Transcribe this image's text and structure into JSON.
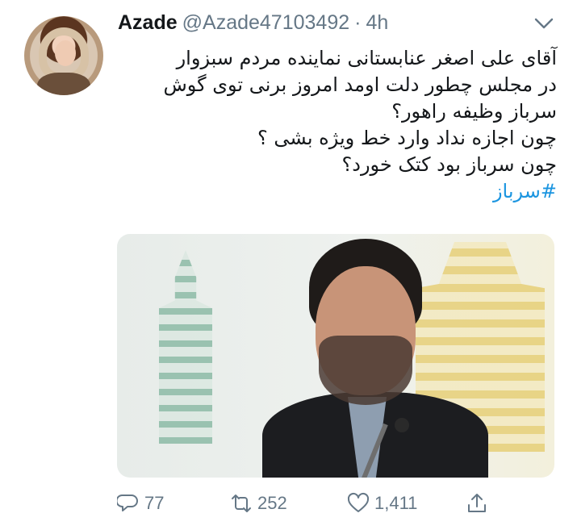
{
  "tweet": {
    "author_name": "Azade",
    "author_handle": "@Azade47103492",
    "separator": "·",
    "time": "4h",
    "lines": [
      "آقای علی اصغر عنابستانی نماینده مردم سبزوار",
      "در مجلس چطور دلت اومد امروز برنی توی گوش",
      "سرباز وظیفه راهور؟",
      "چون اجازه نداد وارد خط ویژه بشی ؟",
      "چون سرباز بود کتک خورد؟"
    ],
    "hashtag": "#سرباز"
  },
  "actions": {
    "replies": "77",
    "retweets": "252",
    "likes": "1,411"
  },
  "icons": {
    "menu": "chevron-down-icon",
    "reply": "reply-icon",
    "retweet": "retweet-icon",
    "like": "heart-icon",
    "share": "share-icon"
  },
  "colors": {
    "text": "#14171a",
    "muted": "#657786",
    "link": "#1b95e0"
  }
}
